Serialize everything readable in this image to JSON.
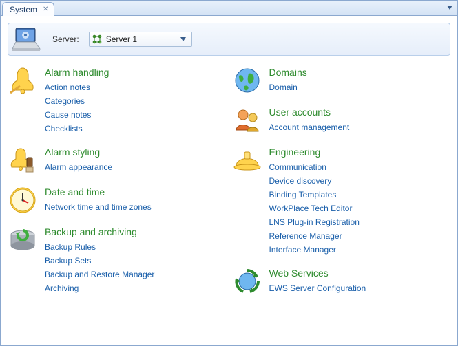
{
  "tab": {
    "title": "System"
  },
  "header": {
    "server_label": "Server:",
    "server_value": "Server 1"
  },
  "left_sections": [
    {
      "title": "Alarm handling",
      "icon": "bell",
      "links": [
        "Action notes",
        "Categories",
        "Cause notes",
        "Checklists"
      ]
    },
    {
      "title": "Alarm styling",
      "icon": "bell-brush",
      "links": [
        "Alarm appearance"
      ]
    },
    {
      "title": "Date and time",
      "icon": "clock",
      "links": [
        "Network time and time zones"
      ]
    },
    {
      "title": "Backup and archiving",
      "icon": "backup",
      "links": [
        "Backup Rules",
        "Backup Sets",
        "Backup and Restore Manager",
        "Archiving"
      ]
    }
  ],
  "right_sections": [
    {
      "title": "Domains",
      "icon": "globe",
      "links": [
        "Domain"
      ]
    },
    {
      "title": "User accounts",
      "icon": "users",
      "links": [
        "Account management"
      ]
    },
    {
      "title": "Engineering",
      "icon": "hardhat",
      "links": [
        "Communication",
        "Device discovery",
        "Binding Templates",
        "WorkPlace Tech Editor",
        "LNS Plug-in Registration",
        "Reference Manager",
        "Interface Manager"
      ]
    },
    {
      "title": "Web Services",
      "icon": "recycle",
      "links": [
        "EWS Server Configuration"
      ]
    }
  ]
}
